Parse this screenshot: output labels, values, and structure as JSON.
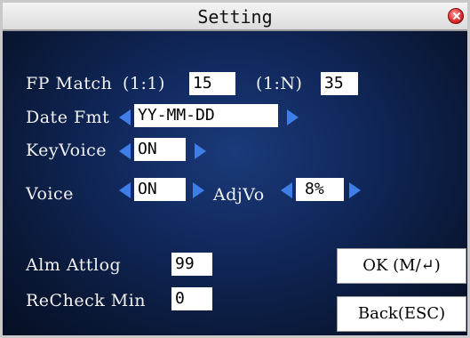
{
  "window": {
    "title": "Setting"
  },
  "fp_match": {
    "label": "FP Match",
    "one_to_one_label": "(1:1)",
    "one_to_one_value": "15",
    "one_to_n_label": "(1:N)",
    "one_to_n_value": "35"
  },
  "date_fmt": {
    "label": "Date Fmt",
    "value": "YY-MM-DD"
  },
  "key_voice": {
    "label": "KeyVoice",
    "value": "ON"
  },
  "voice": {
    "label": "Voice",
    "value": "ON",
    "adj_label": "AdjVo",
    "adj_value": "8%"
  },
  "alm_attlog": {
    "label": "Alm Attlog",
    "value": "99"
  },
  "recheck_min": {
    "label": "ReCheck Min",
    "value": "0"
  },
  "buttons": {
    "ok": "OK (M/↵)",
    "back": "Back(ESC)"
  },
  "colors": {
    "background": "#10275a",
    "arrow": "#3d7fe6",
    "close": "#e03030"
  }
}
